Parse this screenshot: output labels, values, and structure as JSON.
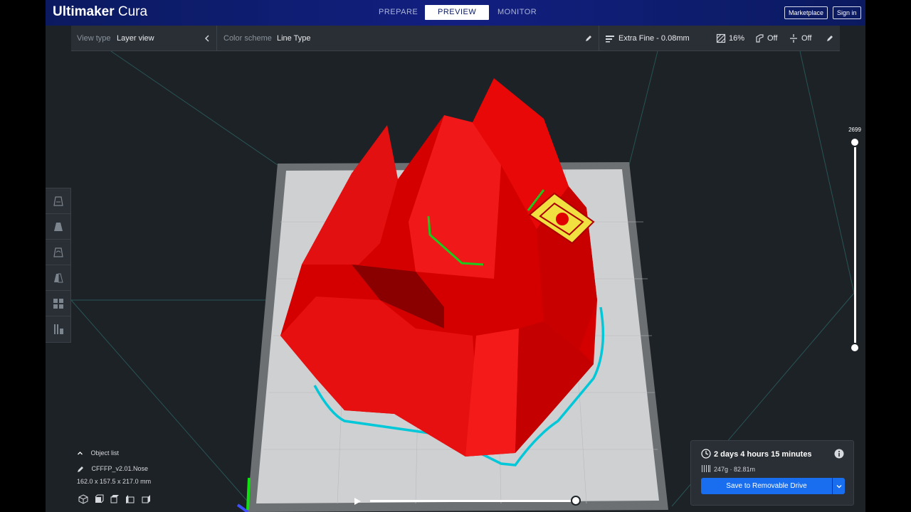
{
  "app": {
    "logo_brand": "Ultimaker",
    "logo_product": "Cura"
  },
  "header": {
    "stages": [
      {
        "label": "PREPARE",
        "active": false
      },
      {
        "label": "PREVIEW",
        "active": true
      },
      {
        "label": "MONITOR",
        "active": false
      }
    ],
    "marketplace_label": "Marketplace",
    "signin_label": "Sign in"
  },
  "stagebar": {
    "view_type_label": "View type",
    "view_type_value": "Layer view",
    "color_scheme_label": "Color scheme",
    "color_scheme_value": "Line Type",
    "profile_label": "Extra Fine - 0.08mm",
    "infill_label": "16%",
    "support_label": "Off",
    "adhesion_label": "Off"
  },
  "toolbar": {
    "tools": [
      "move-tool-icon",
      "scale-tool-icon",
      "rotate-tool-icon",
      "mirror-tool-icon",
      "per-model-settings-icon",
      "support-blocker-icon"
    ]
  },
  "layer_slider": {
    "current_layer": "2699"
  },
  "object_list": {
    "toggle_label": "Object list",
    "object_name": "CFFFP_v2.01.Nose",
    "dimensions": "162.0 x 157.5 x 217.0 mm"
  },
  "print_info": {
    "time": "2 days 4 hours 15 minutes",
    "material": "247g · 82.81m",
    "save_label": "Save to Removable Drive"
  },
  "colors": {
    "header_bg": "#0b1a60",
    "accent_blue": "#196ef0",
    "panel_bg": "#2a2f35",
    "viewport_bg": "#1d2226",
    "model_red": "#e00000",
    "skirt_cyan": "#00c8d8",
    "top_yellow": "#f0e040"
  }
}
